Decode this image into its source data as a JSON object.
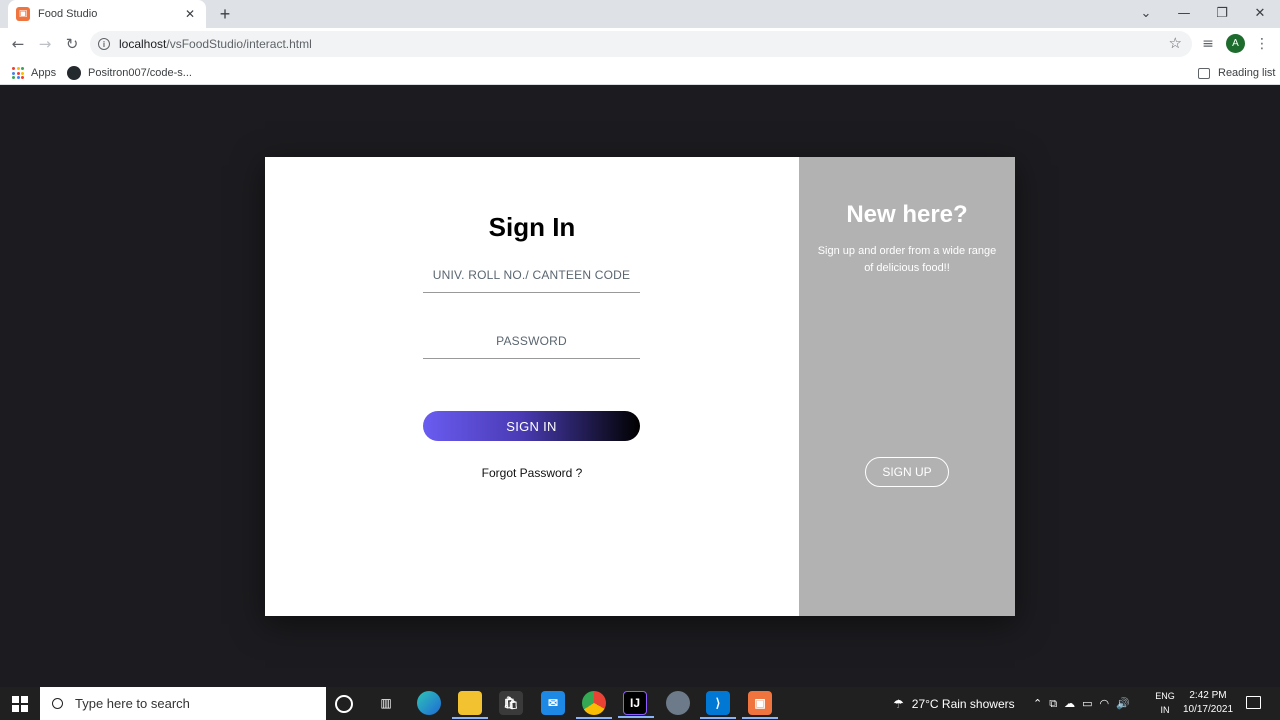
{
  "browser": {
    "tab_title": "Food Studio",
    "url_host": "localhost",
    "url_path": "/vsFoodStudio/interact.html",
    "avatar_letter": "A",
    "bookmarks": [
      {
        "label": "Apps"
      },
      {
        "label": "Positron007/code-s..."
      }
    ],
    "reading_list": "Reading list"
  },
  "signin": {
    "title": "Sign In",
    "id_placeholder": "UNIV. ROLL NO./ CANTEEN CODE",
    "password_placeholder": "PASSWORD",
    "button_label": "SIGN IN",
    "forgot_label": "Forgot Password ?"
  },
  "signup": {
    "title": "New here?",
    "text": "Sign up and order from a wide range of delicious food!!",
    "button_label": "SIGN UP"
  },
  "taskbar": {
    "search_placeholder": "Type here to search",
    "weather": "27°C  Rain showers",
    "lang_top": "ENG",
    "lang_bottom": "IN",
    "time": "2:42 PM",
    "date": "10/17/2021"
  },
  "colors": {
    "page_bg": "#1c1c20",
    "right_panel": "#b2b2b2",
    "signin_gradient_start": "#6a5cf0",
    "signin_gradient_end": "#000000"
  }
}
